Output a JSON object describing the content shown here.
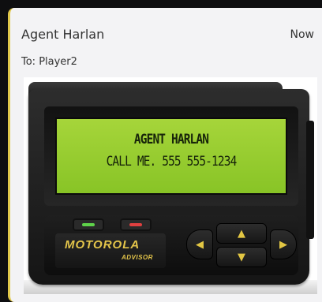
{
  "message": {
    "sender": "Agent Harlan",
    "recipient": "To: Player2",
    "time": "Now"
  },
  "pager": {
    "screen_line1": "AGENT HARLAN",
    "screen_line2": "CALL ME. 555 555-1234",
    "brand": "MOTOROLA",
    "model": "ADVISOR",
    "icons": {
      "left": "triangle-left-icon",
      "right": "triangle-right-icon",
      "up": "triangle-up-icon",
      "down": "triangle-down-icon"
    }
  },
  "colors": {
    "card_background": "#f3f3f5",
    "card_accent": "#e1c84a",
    "lcd": "#98cb30",
    "led_green": "#5fd24a",
    "led_red": "#e04040",
    "brand_gold": "#e4c54a"
  }
}
